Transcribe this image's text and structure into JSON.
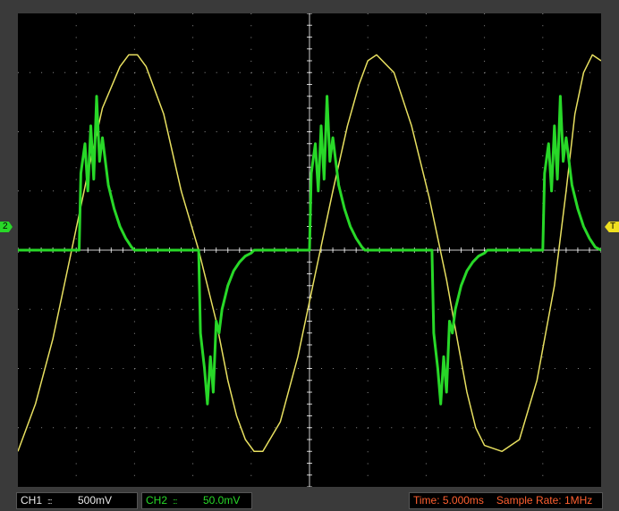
{
  "channels": {
    "ch1": {
      "name": "CH1",
      "coupling": ":::",
      "scale": "500mV",
      "color": "#e8e060"
    },
    "ch2": {
      "name": "CH2",
      "coupling": ":::",
      "scale": "50.0mV",
      "color": "#28d828"
    }
  },
  "markers": {
    "ch2": "2",
    "trigger": "T"
  },
  "timebase": {
    "time": "Time: 5.000ms",
    "sample_rate": "Sample Rate: 1MHz"
  },
  "colors": {
    "grid": "#ffffff",
    "background": "#000000",
    "frame": "#3a3a3a",
    "status_time": "#ff6030"
  },
  "chart_data": {
    "type": "line",
    "grid": true,
    "divisions": {
      "x": 10,
      "y": 8
    },
    "xlabel": "",
    "ylabel": "",
    "xlim": [
      0,
      10
    ],
    "ylim": [
      -4,
      4
    ],
    "units": "divisions",
    "series": [
      {
        "name": "CH1",
        "color": "#e8e060",
        "x": [
          0,
          0.3,
          0.6,
          0.9,
          1.2,
          1.45,
          1.75,
          1.9,
          2.05,
          2.2,
          2.5,
          2.8,
          3.1,
          3.4,
          3.6,
          3.75,
          3.9,
          4.05,
          4.2,
          4.5,
          4.8,
          5.1,
          5.4,
          5.65,
          5.85,
          6.0,
          6.15,
          6.45,
          6.75,
          7.05,
          7.35,
          7.55,
          7.7,
          7.85,
          8.0,
          8.3,
          8.6,
          8.9,
          9.2,
          9.4,
          9.55,
          9.7,
          9.85,
          10.0
        ],
        "y": [
          -3.4,
          -2.6,
          -1.5,
          -0.1,
          1.3,
          2.4,
          3.1,
          3.3,
          3.3,
          3.1,
          2.3,
          1.0,
          0.0,
          -1.2,
          -2.2,
          -2.8,
          -3.2,
          -3.4,
          -3.4,
          -2.9,
          -1.8,
          -0.4,
          1.0,
          2.1,
          2.8,
          3.2,
          3.3,
          3.0,
          2.1,
          0.9,
          -0.5,
          -1.6,
          -2.4,
          -3.0,
          -3.3,
          -3.4,
          -3.2,
          -2.2,
          -0.6,
          1.0,
          2.3,
          3.0,
          3.3,
          3.2
        ]
      },
      {
        "name": "CH2",
        "color": "#28d828",
        "x": [
          0,
          1.05,
          1.08,
          1.15,
          1.2,
          1.25,
          1.3,
          1.35,
          1.4,
          1.45,
          1.55,
          1.65,
          1.75,
          1.85,
          1.95,
          2.0,
          3.1,
          3.13,
          3.2,
          3.25,
          3.3,
          3.35,
          3.4,
          3.45,
          3.5,
          3.6,
          3.7,
          3.8,
          3.9,
          4.0,
          4.05,
          5.0,
          5.03,
          5.1,
          5.15,
          5.2,
          5.25,
          5.3,
          5.35,
          5.4,
          5.5,
          5.6,
          5.7,
          5.8,
          5.9,
          5.95,
          7.1,
          7.13,
          7.2,
          7.25,
          7.3,
          7.35,
          7.4,
          7.45,
          7.5,
          7.6,
          7.7,
          7.8,
          7.9,
          8.0,
          8.05,
          9.0,
          9.03,
          9.1,
          9.15,
          9.2,
          9.25,
          9.3,
          9.35,
          9.4,
          9.5,
          9.6,
          9.7,
          9.8,
          9.9,
          10.0
        ],
        "y": [
          0,
          0,
          1.3,
          1.8,
          1.0,
          2.1,
          1.2,
          2.6,
          1.5,
          1.9,
          1.1,
          0.7,
          0.4,
          0.2,
          0.05,
          0,
          0,
          -1.4,
          -2.0,
          -2.6,
          -1.8,
          -2.4,
          -1.2,
          -1.4,
          -1.0,
          -0.6,
          -0.35,
          -0.2,
          -0.1,
          -0.05,
          0,
          0,
          1.3,
          1.8,
          1.0,
          2.1,
          1.2,
          2.6,
          1.5,
          1.9,
          1.1,
          0.7,
          0.4,
          0.2,
          0.05,
          0,
          0,
          -1.4,
          -2.0,
          -2.6,
          -1.8,
          -2.4,
          -1.2,
          -1.4,
          -1.0,
          -0.6,
          -0.35,
          -0.2,
          -0.1,
          -0.05,
          0,
          0,
          1.3,
          1.8,
          1.0,
          2.1,
          1.2,
          2.6,
          1.5,
          1.9,
          1.1,
          0.7,
          0.4,
          0.2,
          0.05,
          0.0
        ]
      }
    ]
  }
}
